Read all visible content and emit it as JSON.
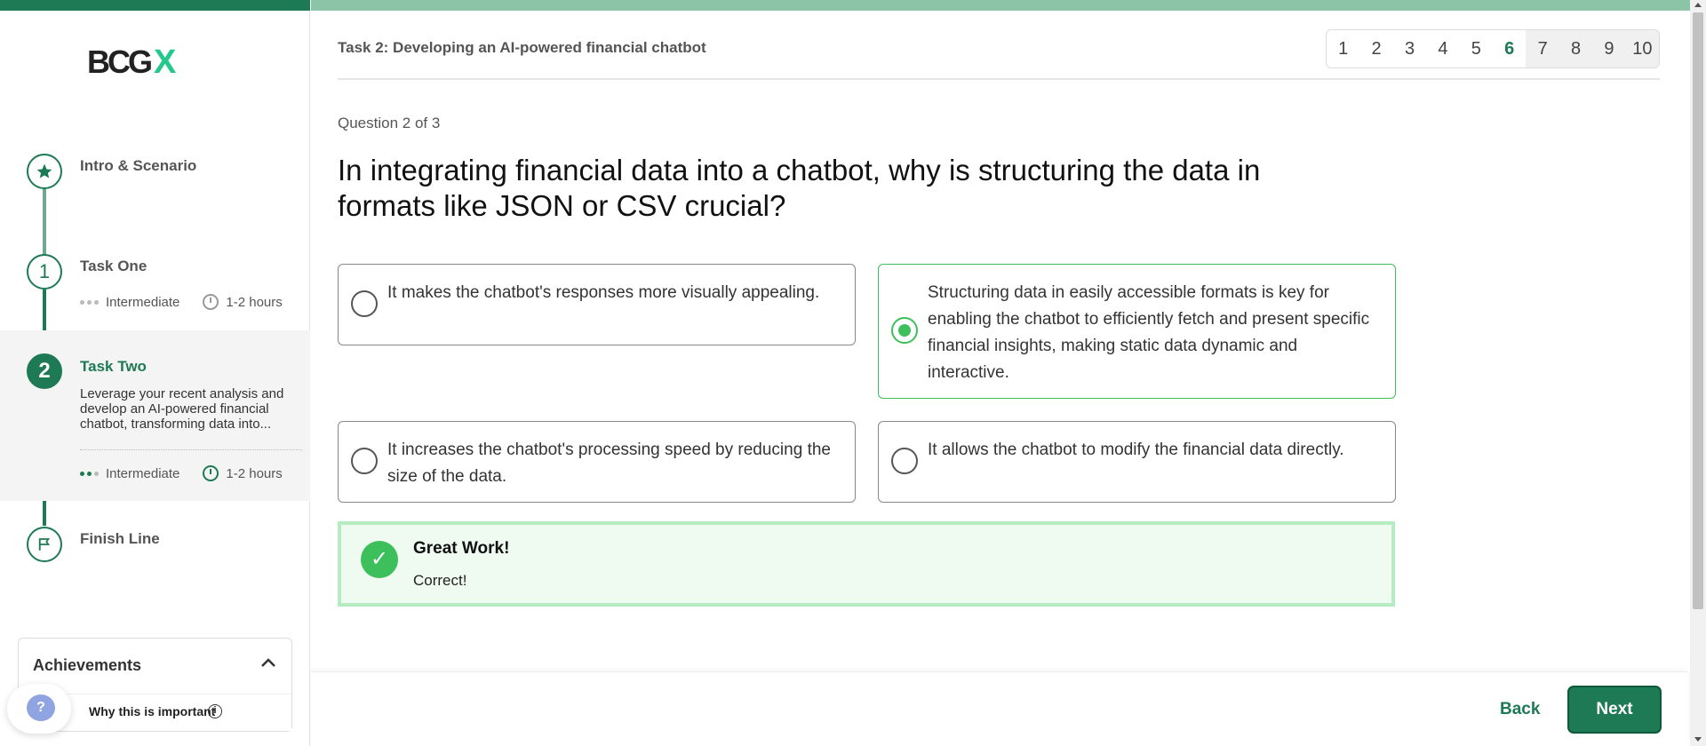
{
  "brand": {
    "logo_text": "BCG",
    "logo_accent": "X",
    "accent_color": "#1e7a54",
    "success_color": "#3dc05c"
  },
  "sidebar": {
    "steps": [
      {
        "icon": "star-icon",
        "title": "Intro & Scenario"
      },
      {
        "number": "1",
        "title": "Task One",
        "level": "Intermediate",
        "duration": "1-2 hours"
      },
      {
        "number": "2",
        "title": "Task Two",
        "description": "Leverage your recent analysis and develop an AI-powered financial chatbot, transforming data into...",
        "level": "Intermediate",
        "duration": "1-2 hours"
      },
      {
        "icon": "flag-icon",
        "title": "Finish Line"
      }
    ],
    "achievements": {
      "title": "Achievements",
      "why_label": "Why this is important"
    },
    "help_label": "?"
  },
  "header": {
    "task_title": "Task 2: Developing an AI-powered financial chatbot",
    "pages": [
      "1",
      "2",
      "3",
      "4",
      "5",
      "6",
      "7",
      "8",
      "9",
      "10"
    ],
    "current_page": "6"
  },
  "question": {
    "counter": "Question 2 of 3",
    "text": "In integrating financial data into a chatbot, why is structuring the data in formats like JSON or CSV crucial?",
    "options": [
      {
        "text": "It makes the chatbot's responses more visually appealing.",
        "selected": false
      },
      {
        "text": "Structuring data in easily accessible formats is key for enabling the chatbot to efficiently fetch and present specific financial insights, making static data dynamic and interactive.",
        "selected": true
      },
      {
        "text": "It increases the chatbot's processing speed by reducing the size of the data.",
        "selected": false
      },
      {
        "text": "It allows the chatbot to modify the financial data directly.",
        "selected": false
      }
    ]
  },
  "feedback": {
    "title": "Great Work!",
    "body": "Correct!"
  },
  "footer": {
    "back_label": "Back",
    "next_label": "Next"
  }
}
